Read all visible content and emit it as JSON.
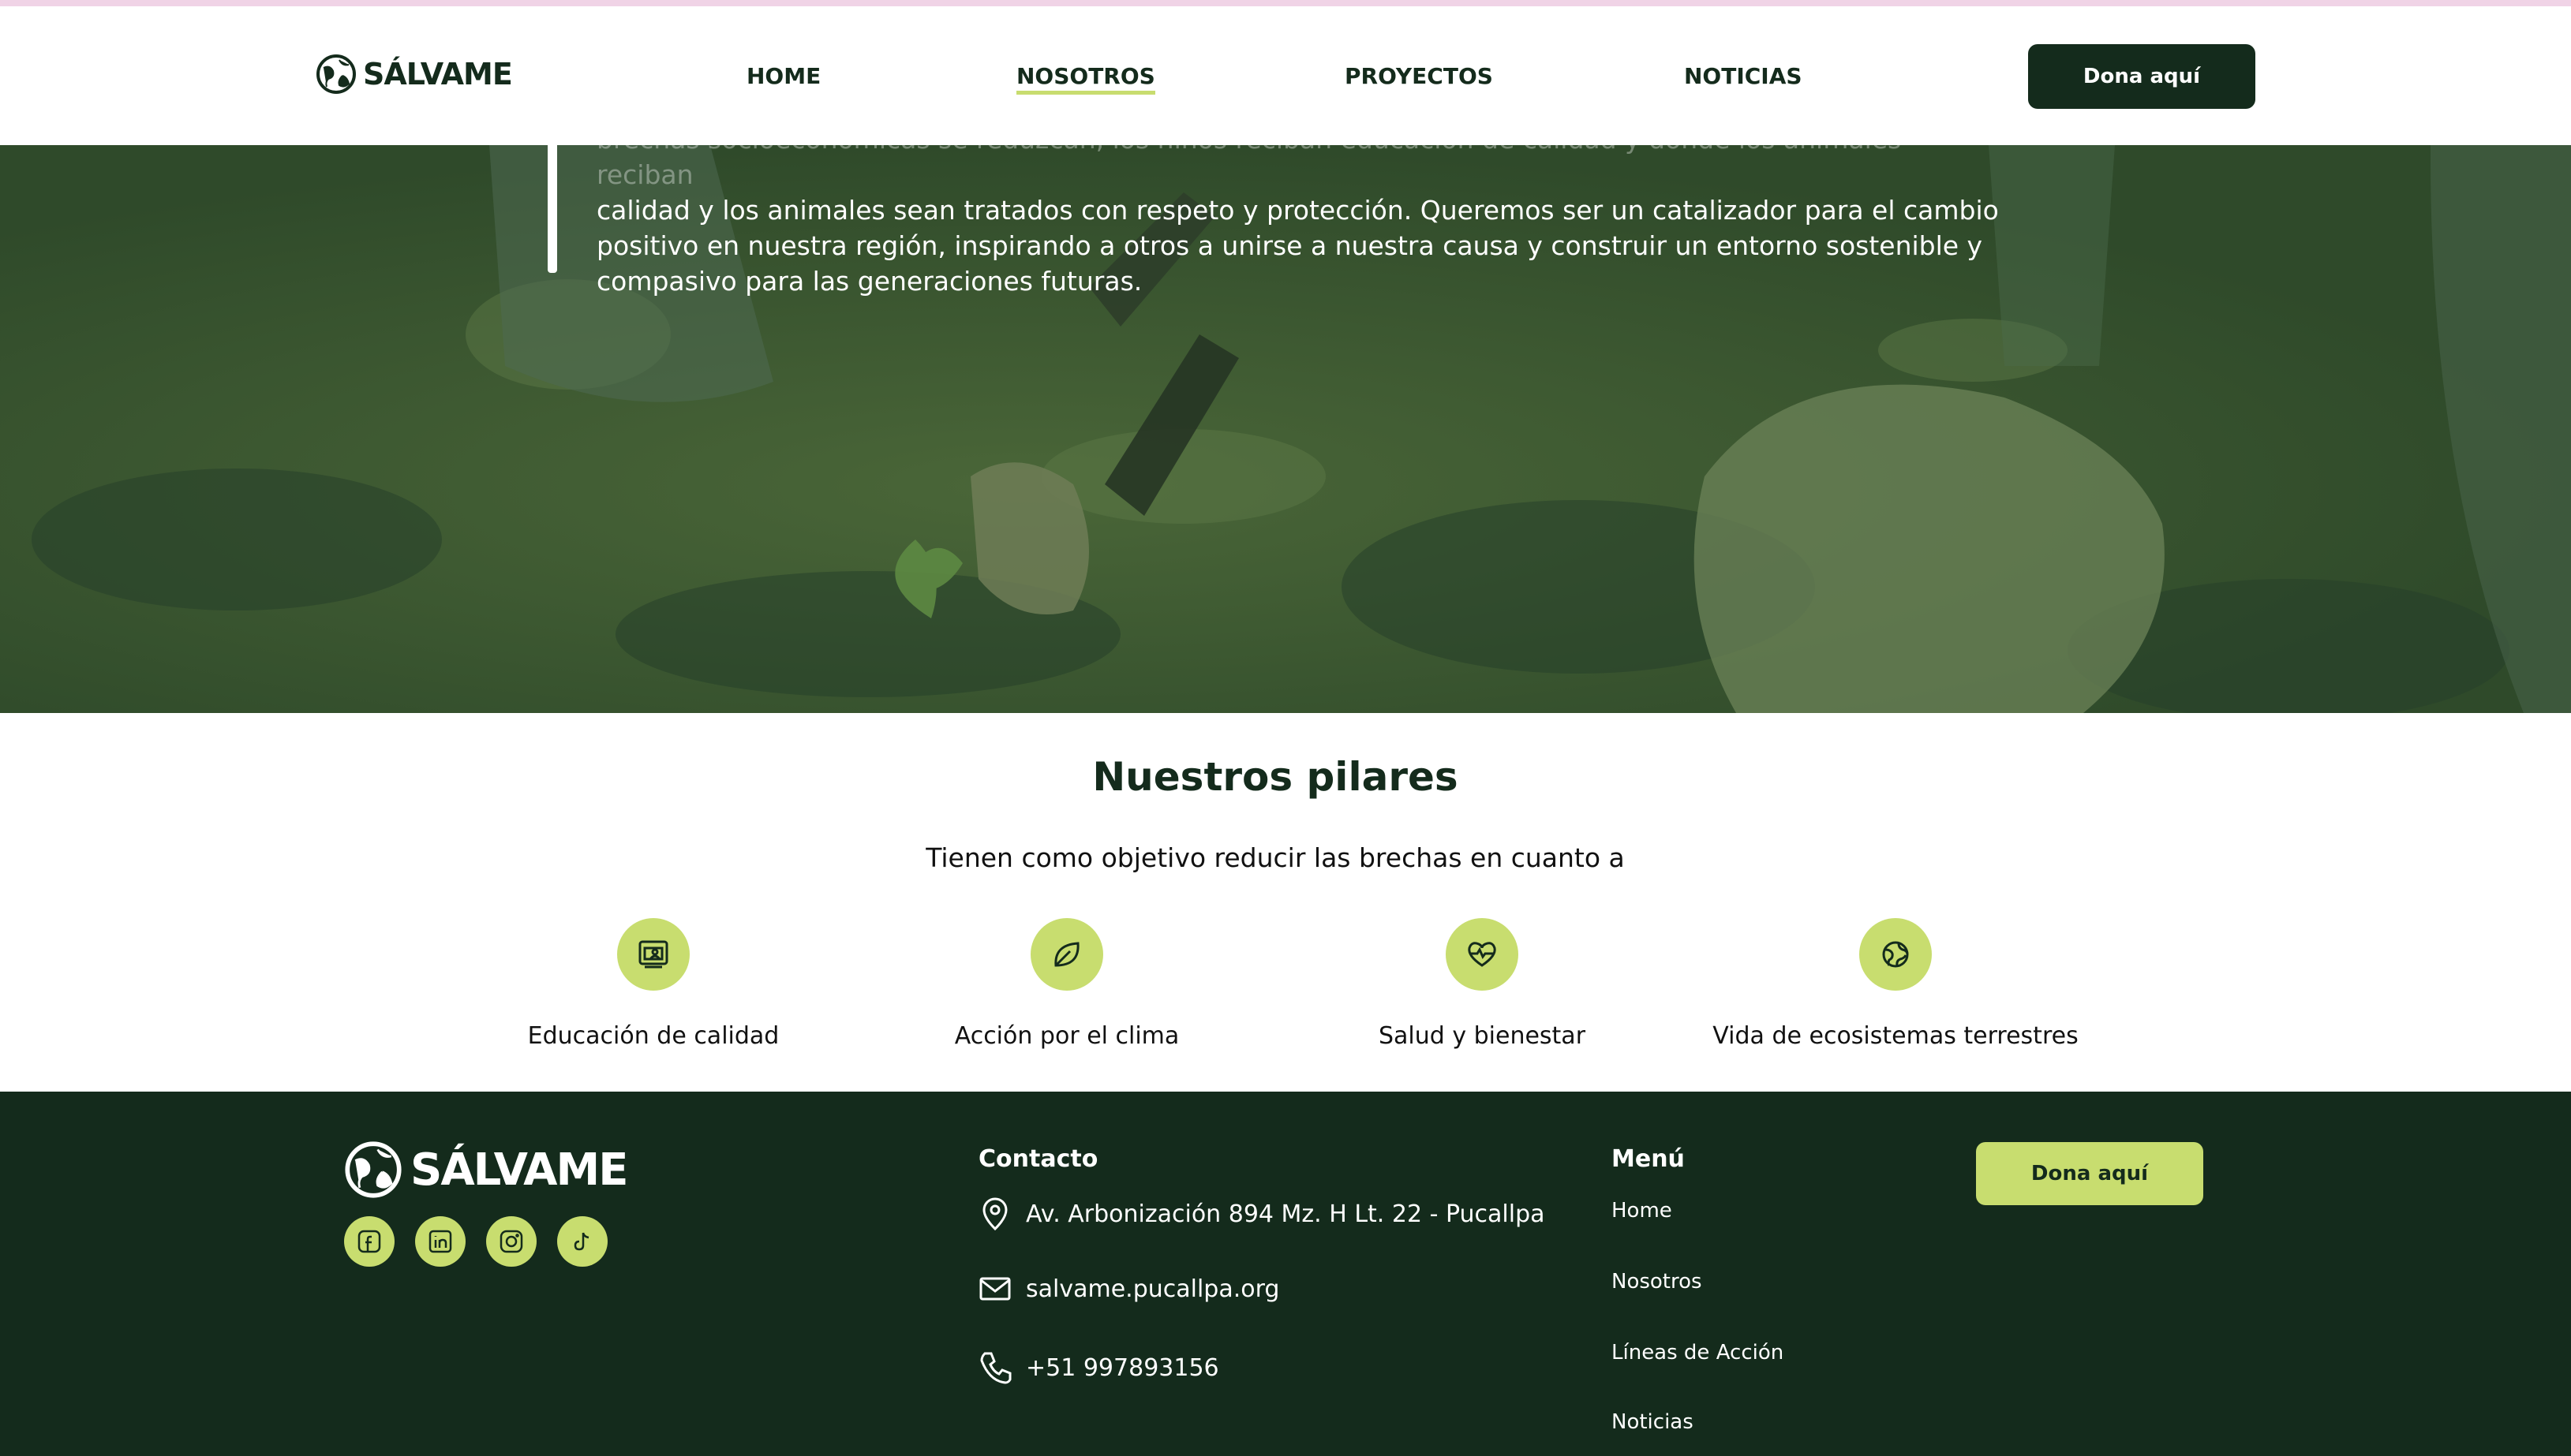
{
  "header": {
    "brand": "SÁLVAME",
    "nav": [
      {
        "label": "HOME"
      },
      {
        "label": "NOSOTROS",
        "active": true
      },
      {
        "label": "PROYECTOS"
      },
      {
        "label": "NOTICIAS"
      }
    ],
    "donate_label": "Dona aquí"
  },
  "hero": {
    "text_faded": "brechas socioeconómicas se reduzcan, los niños reciban educación de calidad y donde los animales reciban",
    "text_visible": "calidad y los animales sean tratados con respeto y protección. Queremos ser un catalizador para el cambio positivo en nuestra región, inspirando a otros a unirse a nuestra causa y construir un entorno sostenible y compasivo para las generaciones futuras."
  },
  "pillars": {
    "title": "Nuestros pilares",
    "subtitle": "Tienen como objetivo reducir las brechas en cuanto a",
    "items": [
      {
        "icon": "education-icon",
        "label": "Educación de calidad"
      },
      {
        "icon": "leaf-icon",
        "label": "Acción por el clima"
      },
      {
        "icon": "heart-pulse-icon",
        "label": "Salud y bienestar"
      },
      {
        "icon": "globe-icon",
        "label": "Vida de ecosistemas terrestres"
      }
    ]
  },
  "footer": {
    "brand": "SÁLVAME",
    "socials": [
      "facebook-icon",
      "linkedin-icon",
      "instagram-icon",
      "tiktok-icon"
    ],
    "contact_heading": "Contacto",
    "address": "Av. Arbonización 894 Mz. H Lt. 22 - Pucallpa",
    "email": "salvame.pucallpa.org",
    "phone": "+51 997893156",
    "menu_heading": "Menú",
    "menu": [
      {
        "label": "Home"
      },
      {
        "label": "Nosotros"
      },
      {
        "label": "Líneas de Acción"
      },
      {
        "label": "Noticias"
      }
    ],
    "donate_label": "Dona aquí"
  },
  "colors": {
    "dark_green": "#142b1c",
    "lime": "#c8dd6f",
    "hero_overlay": "#3c5a31"
  }
}
